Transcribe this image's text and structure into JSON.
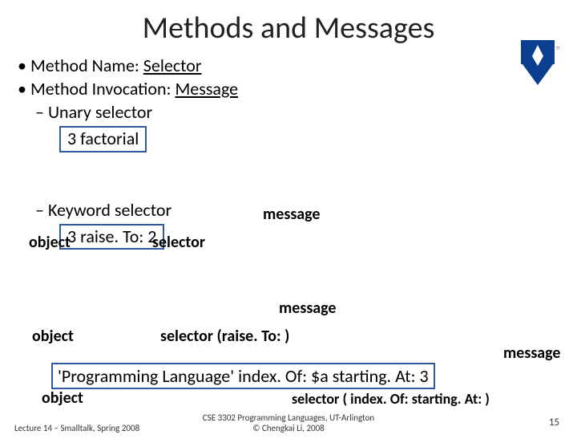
{
  "title": "Methods and Messages",
  "bullets": {
    "method_name": "Method Name: ",
    "selector_word": "Selector",
    "method_invocation": "Method Invocation: ",
    "message_word": "Message",
    "unary": "Unary selector",
    "keyword": "Keyword selector"
  },
  "code": {
    "unary_expr": "3  factorial",
    "keyword_expr": "3  raise. To:  2",
    "long_expr": "'Programming Language'   index. Of: $a   starting. At: 3"
  },
  "labels": {
    "object": "object",
    "selector": "selector",
    "message": "message",
    "selector_raise": "selector   (raise. To: )",
    "selector_long": "selector   ( index. Of: starting. At: )"
  },
  "footer": {
    "left": "Lecture 14 – Smalltalk, Spring 2008",
    "center_l1": "CSE 3302 Programming Languages, UT-Arlington",
    "center_l2": "© Chengkai Li, 2008",
    "right": "15"
  }
}
